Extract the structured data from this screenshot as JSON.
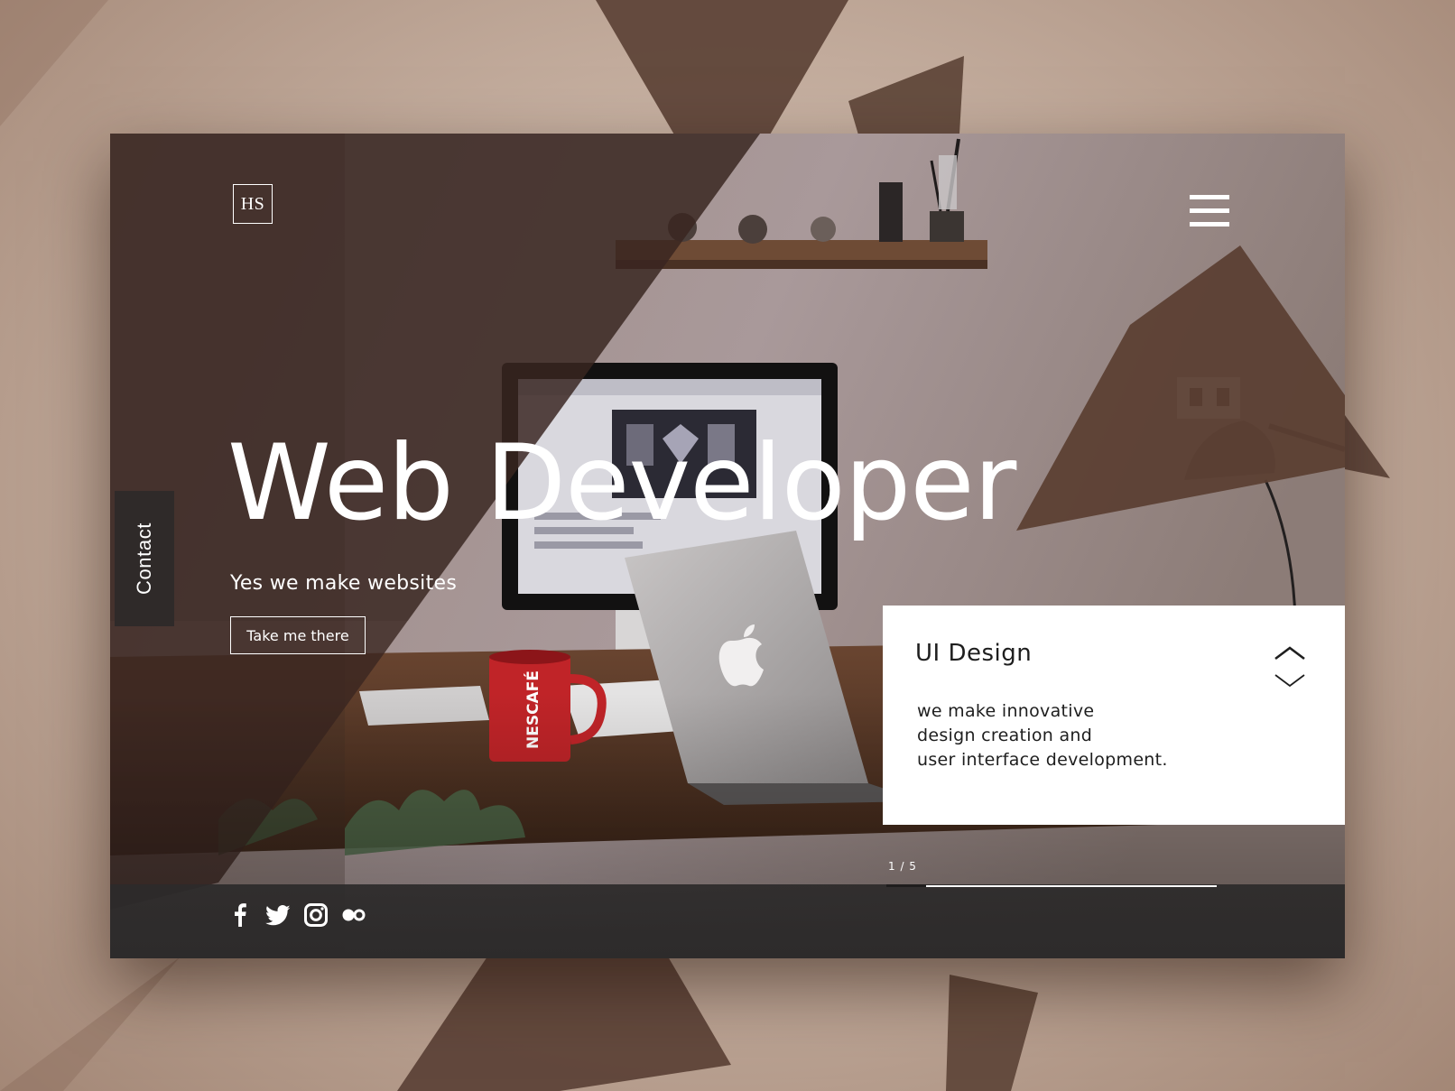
{
  "brand": {
    "logo_text": "HS"
  },
  "nav": {
    "menu_icon": "hamburger-icon",
    "contact_label": "Contact"
  },
  "hero": {
    "title": "Web Developer",
    "subtitle": "Yes we make websites",
    "cta_label": "Take me there"
  },
  "slide": {
    "title": "UI Design",
    "description_lines": [
      "we make innovative",
      "design creation and",
      "user interface development."
    ],
    "counter": "1 / 5",
    "progress": 0.12,
    "prev_icon": "chevron-up-icon",
    "next_icon": "chevron-down-icon"
  },
  "socials": [
    {
      "name": "facebook",
      "icon": "facebook-icon"
    },
    {
      "name": "twitter",
      "icon": "twitter-icon"
    },
    {
      "name": "instagram",
      "icon": "instagram-icon"
    },
    {
      "name": "flickr",
      "icon": "flickr-icon"
    }
  ],
  "colors": {
    "accent_brown": "#5a3f33",
    "dark_overlay": "#3a2a24",
    "footer": "#2d2b2b",
    "text_light": "#ffffff",
    "text_dark": "#1e1e1e"
  }
}
